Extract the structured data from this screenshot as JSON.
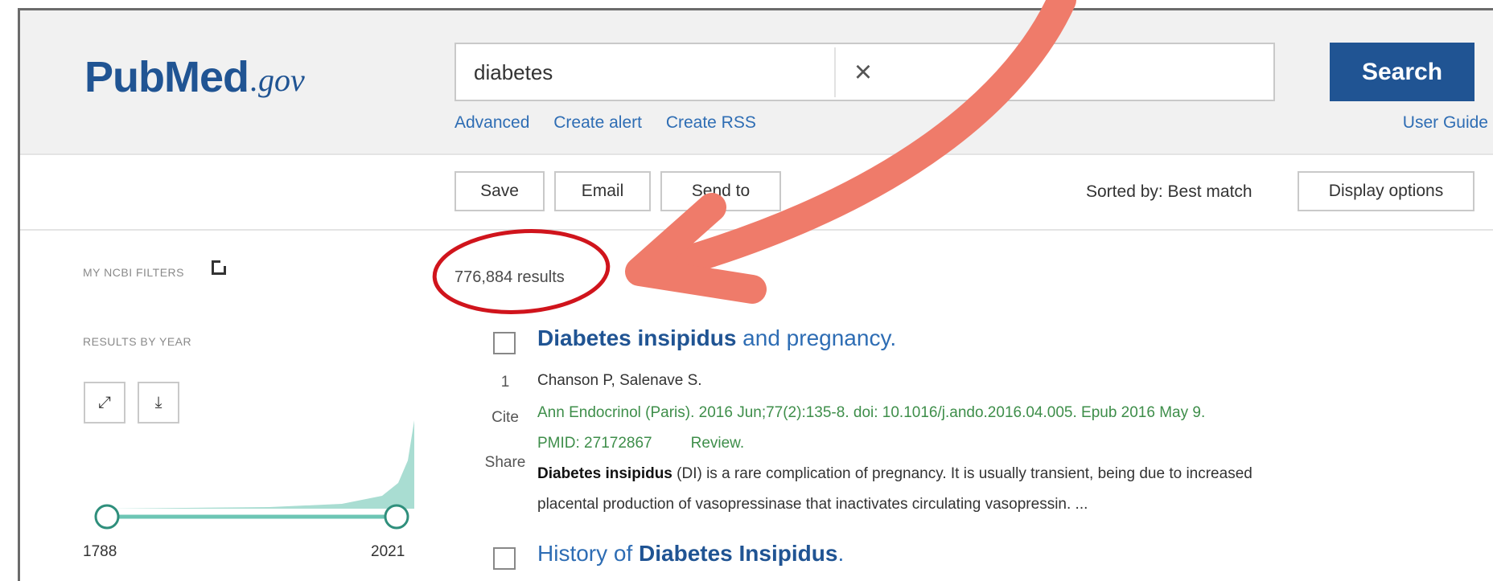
{
  "brand": {
    "pub": "Pub",
    "med": "Med",
    "gov": ".gov"
  },
  "search": {
    "value": "diabetes",
    "button_label": "Search",
    "clear_glyph": "×"
  },
  "sublinks": [
    "Advanced",
    "Create alert",
    "Create RSS"
  ],
  "user_guide": "User Guide",
  "toolbar": {
    "save": "Save",
    "email": "Email",
    "send_to": "Send to",
    "sorted_by": "Sorted by: Best match",
    "display_options": "Display options"
  },
  "sidebar": {
    "filters_heading": "MY NCBI FILTERS",
    "results_heading": "RESULTS BY YEAR",
    "year_start": "1788",
    "year_end": "2021",
    "expand_icon": "expand-icon",
    "download_icon": "download-icon"
  },
  "results": {
    "count": "776,884 results",
    "items": [
      {
        "number": "1",
        "title_bold": "Diabetes insipidus",
        "title_rest": " and pregnancy.",
        "authors": "Chanson P, Salenave S.",
        "citation": "Ann Endocrinol (Paris). 2016 Jun;77(2):135-8. doi: 10.1016/j.ando.2016.04.005. Epub 2016 May 9.",
        "pmid": "PMID: 27172867",
        "type": "Review.",
        "cite": "Cite",
        "share": "Share",
        "snippet_bold": "Diabetes insipidus",
        "snippet_line1": " (DI) is a rare complication of pregnancy. It is usually transient, being due to increased",
        "snippet_line2": "placental production of vasopressinase that inactivates circulating vasopressin. ..."
      },
      {
        "title_pre": "History of ",
        "title_bold": "Diabetes Insipidus",
        "title_post": "."
      }
    ]
  },
  "colors": {
    "brand": "#205493",
    "link": "#2e6db4",
    "citation": "#3e8e4a",
    "annotation_arrow": "#ef7b6a",
    "annotation_circle": "#d0141c",
    "timeline": "#6cc5b4"
  }
}
